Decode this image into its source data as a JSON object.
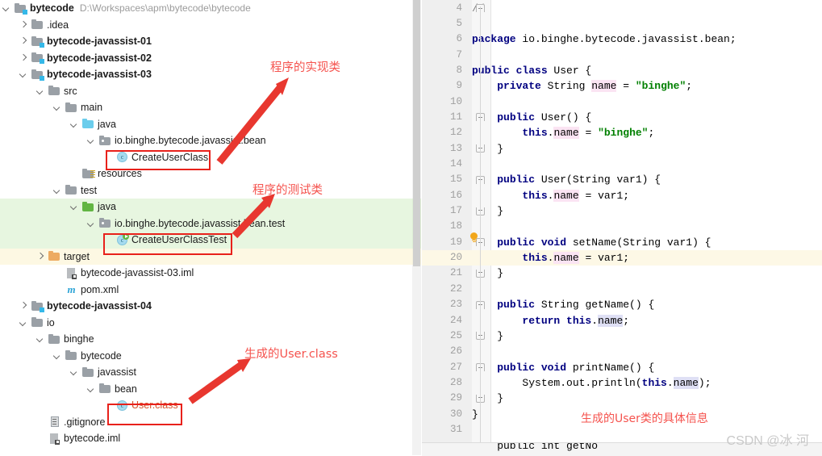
{
  "project_tree": {
    "scrollbar": "vertical-scrollbar",
    "rows": [
      {
        "indent": 0,
        "twisty": "down",
        "icon": "module-folder-icon",
        "label": "bytecode",
        "bold": true,
        "path": "D:\\Workspaces\\apm\\bytecode\\bytecode"
      },
      {
        "indent": 1,
        "twisty": "right",
        "icon": "folder-icon",
        "label": ".idea",
        "bold": false
      },
      {
        "indent": 1,
        "twisty": "right",
        "icon": "module-folder-icon",
        "label": "bytecode-javassist-01",
        "bold": true
      },
      {
        "indent": 1,
        "twisty": "right",
        "icon": "module-folder-icon",
        "label": "bytecode-javassist-02",
        "bold": true
      },
      {
        "indent": 1,
        "twisty": "down",
        "icon": "module-folder-icon",
        "label": "bytecode-javassist-03",
        "bold": true
      },
      {
        "indent": 2,
        "twisty": "down",
        "icon": "folder-icon",
        "label": "src",
        "bold": false
      },
      {
        "indent": 3,
        "twisty": "down",
        "icon": "folder-icon",
        "label": "main",
        "bold": false
      },
      {
        "indent": 4,
        "twisty": "down",
        "icon": "source-root-folder-icon",
        "label": "java",
        "bold": false
      },
      {
        "indent": 5,
        "twisty": "down",
        "icon": "package-icon",
        "label": "io.binghe.bytecode.javassist.bean",
        "bold": false
      },
      {
        "indent": 6,
        "twisty": "none",
        "icon": "java-class-icon",
        "label": "CreateUserClass",
        "bold": false
      },
      {
        "indent": 4,
        "twisty": "none",
        "icon": "resources-folder-icon",
        "label": "resources",
        "bold": false
      },
      {
        "indent": 3,
        "twisty": "down",
        "icon": "folder-icon",
        "label": "test",
        "bold": false
      },
      {
        "indent": 4,
        "twisty": "down",
        "icon": "test-source-root-folder-icon",
        "label": "java",
        "bold": false,
        "highlight": "green"
      },
      {
        "indent": 5,
        "twisty": "down",
        "icon": "package-icon",
        "label": "io.binghe.bytecode.javassist.bean.test",
        "bold": false,
        "highlight": "green"
      },
      {
        "indent": 6,
        "twisty": "none",
        "icon": "java-test-class-icon",
        "label": "CreateUserClassTest",
        "bold": false,
        "highlight": "green"
      },
      {
        "indent": 2,
        "twisty": "right",
        "icon": "target-folder-icon",
        "label": "target",
        "bold": false,
        "highlight": "yellow"
      },
      {
        "indent": 3,
        "twisty": "none",
        "icon": "iml-file-icon",
        "label": "bytecode-javassist-03.iml",
        "bold": false
      },
      {
        "indent": 3,
        "twisty": "none",
        "icon": "maven-pom-icon",
        "label": "pom.xml",
        "bold": false
      },
      {
        "indent": 1,
        "twisty": "right",
        "icon": "module-folder-icon",
        "label": "bytecode-javassist-04",
        "bold": true
      },
      {
        "indent": 1,
        "twisty": "down",
        "icon": "folder-icon",
        "label": "io",
        "bold": false
      },
      {
        "indent": 2,
        "twisty": "down",
        "icon": "folder-icon",
        "label": "binghe",
        "bold": false
      },
      {
        "indent": 3,
        "twisty": "down",
        "icon": "folder-icon",
        "label": "bytecode",
        "bold": false
      },
      {
        "indent": 4,
        "twisty": "down",
        "icon": "folder-icon",
        "label": "javassist",
        "bold": false
      },
      {
        "indent": 5,
        "twisty": "down",
        "icon": "folder-icon",
        "label": "bean",
        "bold": false
      },
      {
        "indent": 6,
        "twisty": "none",
        "icon": "java-class-icon",
        "label": "User.class",
        "bold": false,
        "color": "orange"
      },
      {
        "indent": 2,
        "twisty": "none",
        "icon": "gitignore-file-icon",
        "label": ".gitignore",
        "bold": false
      },
      {
        "indent": 2,
        "twisty": "none",
        "icon": "iml-file-icon",
        "label": "bytecode.iml",
        "bold": false
      }
    ]
  },
  "editor": {
    "first_line_number": 4,
    "current_line": 20,
    "intention_icon": "lightbulb-icon",
    "lines": [
      {
        "n": 4,
        "segs": [
          {
            "t": "//",
            "c": "cmt"
          }
        ],
        "fold": "open"
      },
      {
        "n": 5,
        "segs": []
      },
      {
        "n": 6,
        "segs": [
          {
            "t": "package",
            "c": "kw"
          },
          {
            "t": " io.binghe.bytecode.javassist.bean;",
            "c": "plain"
          }
        ]
      },
      {
        "n": 7,
        "segs": []
      },
      {
        "n": 8,
        "segs": [
          {
            "t": "public class",
            "c": "kw"
          },
          {
            "t": " User {",
            "c": "plain"
          }
        ]
      },
      {
        "n": 9,
        "segs": [
          {
            "t": "    ",
            "c": "plain"
          },
          {
            "t": "private",
            "c": "kw"
          },
          {
            "t": " String ",
            "c": "plain"
          },
          {
            "t": "name",
            "c": "hlw"
          },
          {
            "t": " = ",
            "c": "plain"
          },
          {
            "t": "\"binghe\"",
            "c": "str"
          },
          {
            "t": ";",
            "c": "plain"
          }
        ]
      },
      {
        "n": 10,
        "segs": []
      },
      {
        "n": 11,
        "segs": [
          {
            "t": "    ",
            "c": "plain"
          },
          {
            "t": "public",
            "c": "kw"
          },
          {
            "t": " User() {",
            "c": "plain"
          }
        ],
        "fold": "open"
      },
      {
        "n": 12,
        "segs": [
          {
            "t": "        ",
            "c": "plain"
          },
          {
            "t": "this",
            "c": "kw"
          },
          {
            "t": ".",
            "c": "plain"
          },
          {
            "t": "name",
            "c": "hlw"
          },
          {
            "t": " = ",
            "c": "plain"
          },
          {
            "t": "\"binghe\"",
            "c": "str"
          },
          {
            "t": ";",
            "c": "plain"
          }
        ]
      },
      {
        "n": 13,
        "segs": [
          {
            "t": "    }",
            "c": "plain"
          }
        ],
        "fold": "close"
      },
      {
        "n": 14,
        "segs": []
      },
      {
        "n": 15,
        "segs": [
          {
            "t": "    ",
            "c": "plain"
          },
          {
            "t": "public",
            "c": "kw"
          },
          {
            "t": " User(String var1) {",
            "c": "plain"
          }
        ],
        "fold": "open"
      },
      {
        "n": 16,
        "segs": [
          {
            "t": "        ",
            "c": "plain"
          },
          {
            "t": "this",
            "c": "kw"
          },
          {
            "t": ".",
            "c": "plain"
          },
          {
            "t": "name",
            "c": "hlw"
          },
          {
            "t": " = var1;",
            "c": "plain"
          }
        ]
      },
      {
        "n": 17,
        "segs": [
          {
            "t": "    }",
            "c": "plain"
          }
        ],
        "fold": "close"
      },
      {
        "n": 18,
        "segs": []
      },
      {
        "n": 19,
        "segs": [
          {
            "t": "    ",
            "c": "plain"
          },
          {
            "t": "public void",
            "c": "kw"
          },
          {
            "t": " setName(String var1) {",
            "c": "plain"
          }
        ],
        "fold": "open"
      },
      {
        "n": 20,
        "segs": [
          {
            "t": "        ",
            "c": "plain"
          },
          {
            "t": "this",
            "c": "kw"
          },
          {
            "t": ".",
            "c": "plain"
          },
          {
            "t": "name",
            "c": "hlw"
          },
          {
            "t": " = var1;",
            "c": "plain"
          }
        ],
        "current": true
      },
      {
        "n": 21,
        "segs": [
          {
            "t": "    }",
            "c": "plain"
          }
        ],
        "fold": "close"
      },
      {
        "n": 22,
        "segs": []
      },
      {
        "n": 23,
        "segs": [
          {
            "t": "    ",
            "c": "plain"
          },
          {
            "t": "public",
            "c": "kw"
          },
          {
            "t": " String getName() {",
            "c": "plain"
          }
        ],
        "fold": "open"
      },
      {
        "n": 24,
        "segs": [
          {
            "t": "        ",
            "c": "plain"
          },
          {
            "t": "return this",
            "c": "kw"
          },
          {
            "t": ".",
            "c": "plain"
          },
          {
            "t": "name",
            "c": "hlr"
          },
          {
            "t": ";",
            "c": "plain"
          }
        ]
      },
      {
        "n": 25,
        "segs": [
          {
            "t": "    }",
            "c": "plain"
          }
        ],
        "fold": "close"
      },
      {
        "n": 26,
        "segs": []
      },
      {
        "n": 27,
        "segs": [
          {
            "t": "    ",
            "c": "plain"
          },
          {
            "t": "public void",
            "c": "kw"
          },
          {
            "t": " printName() {",
            "c": "plain"
          }
        ],
        "fold": "open"
      },
      {
        "n": 28,
        "segs": [
          {
            "t": "        System.out.println(",
            "c": "plain"
          },
          {
            "t": "this",
            "c": "kw"
          },
          {
            "t": ".",
            "c": "plain"
          },
          {
            "t": "name",
            "c": "hlr"
          },
          {
            "t": ");",
            "c": "plain"
          }
        ]
      },
      {
        "n": 29,
        "segs": [
          {
            "t": "    }",
            "c": "plain"
          }
        ],
        "fold": "close"
      },
      {
        "n": 30,
        "segs": [
          {
            "t": "}",
            "c": "plain"
          }
        ]
      },
      {
        "n": 31,
        "segs": []
      }
    ],
    "clipped_bottom_text": "    public int getNo"
  },
  "annotations": {
    "impl_class": "程序的实现类",
    "test_class": "程序的测试类",
    "generated_class": "生成的User.class",
    "code_note": "生成的User类的具体信息",
    "watermark": "CSDN @冰 河"
  },
  "colors": {
    "annotation_red": "#f5534e",
    "box_red": "#e8211b",
    "arrow_red": "#e8372f",
    "highlight_green": "#e7f6e0",
    "highlight_yellow": "#fdf8e3",
    "current_line": "#fdf8e6",
    "keyword_blue": "#000080",
    "string_green": "#008000"
  }
}
